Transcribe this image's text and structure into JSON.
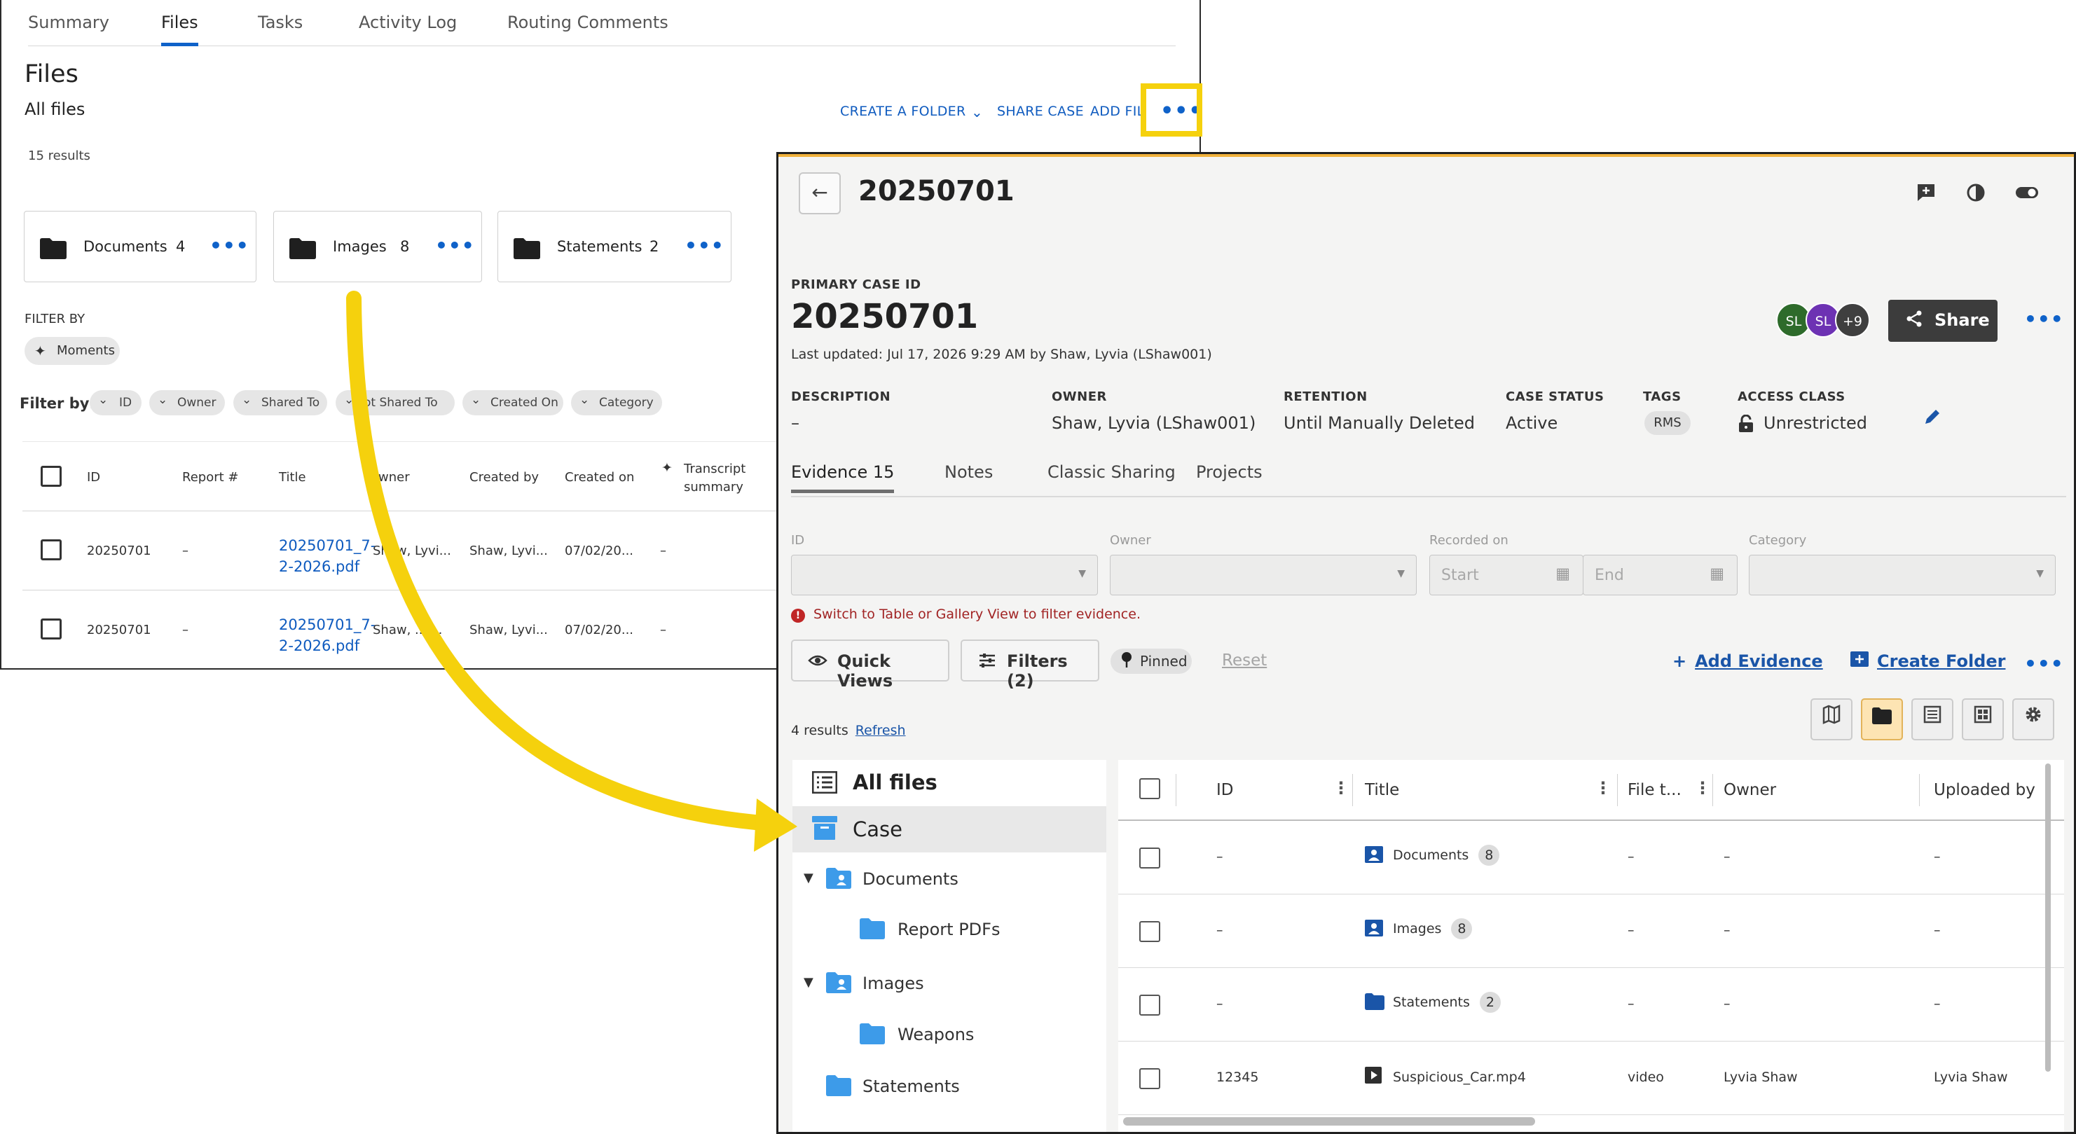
{
  "back_panel": {
    "tabs": [
      "Summary",
      "Files",
      "Tasks",
      "Activity Log",
      "Routing Comments"
    ],
    "title": "Files",
    "subtitle": "All files",
    "results": "15 results",
    "actions": {
      "create_folder": "CREATE A FOLDER",
      "share_case": "SHARE CASE",
      "add_file": "ADD FIL",
      "more": "•••"
    },
    "folders": [
      {
        "name": "Documents",
        "count": "4"
      },
      {
        "name": "Images",
        "count": "8"
      },
      {
        "name": "Statements",
        "count": "2"
      }
    ],
    "filter_by_heading": "FILTER BY",
    "moments_chip": "Moments",
    "filter_by_label": "Filter by:",
    "filter_chips": [
      "ID",
      "Owner",
      "Shared To",
      "ot Shared To",
      "Created On",
      "Category"
    ],
    "table": {
      "headers": [
        "ID",
        "Report #",
        "Title",
        "wner",
        "Created by",
        "Created on",
        "Transcript summary"
      ],
      "rows": [
        {
          "id": "20250701",
          "report": "–",
          "title": "20250701_7-2-2026.pdf",
          "owner": "Shaw, Lyvi...",
          "created_by": "Shaw, Lyvi...",
          "created_on": "07/02/20...",
          "transcript": "–"
        },
        {
          "id": "20250701",
          "report": "–",
          "title": "20250701_7-2-2026.pdf",
          "owner": "Shaw, ...i...",
          "created_by": "Shaw, Lyvi...",
          "created_on": "07/02/20...",
          "transcript": "–"
        }
      ]
    }
  },
  "front_panel": {
    "header_title": "20250701",
    "primary_case_label": "PRIMARY CASE ID",
    "case_id": "20250701",
    "last_updated": "Last updated: Jul 17, 2026 9:29 AM by Shaw, Lyvia (LShaw001)",
    "avatars": [
      {
        "initials": "SL",
        "color": "#2e6b2b"
      },
      {
        "initials": "SL",
        "color": "#6d32b3"
      },
      {
        "initials": "+9",
        "color": "#3f3f3f"
      }
    ],
    "share_button": "Share",
    "meta": [
      {
        "label": "DESCRIPTION",
        "value": "–"
      },
      {
        "label": "OWNER",
        "value": "Shaw, Lyvia (LShaw001)"
      },
      {
        "label": "RETENTION",
        "value": "Until Manually Deleted"
      },
      {
        "label": "CASE STATUS",
        "value": "Active"
      },
      {
        "label": "TAGS",
        "value": "RMS"
      },
      {
        "label": "ACCESS CLASS",
        "value": "Unrestricted"
      }
    ],
    "tabs": [
      "Evidence 15",
      "Notes",
      "Classic Sharing",
      "Projects"
    ],
    "filters": {
      "id_label": "ID",
      "owner_label": "Owner",
      "recorded_label": "Recorded on",
      "start_placeholder": "Start",
      "end_placeholder": "End",
      "category_label": "Category"
    },
    "warning": "Switch to Table or Gallery View to filter evidence.",
    "quick_views": "Quick Views",
    "filters_button": "Filters (2)",
    "pinned": "Pinned",
    "reset": "Reset",
    "add_evidence": "Add Evidence",
    "create_folder": "Create Folder",
    "results": "4 results",
    "refresh": "Refresh",
    "tree": [
      {
        "label": "All files"
      },
      {
        "label": "Case"
      },
      {
        "label": "Documents"
      },
      {
        "label": "Report PDFs"
      },
      {
        "label": "Images"
      },
      {
        "label": "Weapons"
      },
      {
        "label": "Statements"
      }
    ],
    "table": {
      "headers": [
        "ID",
        "Title",
        "File t...",
        "Owner",
        "Uploaded by"
      ],
      "rows": [
        {
          "id": "–",
          "title": "Documents",
          "badge": "8",
          "type": "–",
          "owner": "–",
          "uploaded": "–"
        },
        {
          "id": "–",
          "title": "Images",
          "badge": "8",
          "type": "–",
          "owner": "–",
          "uploaded": "–"
        },
        {
          "id": "–",
          "title": "Statements",
          "badge": "2",
          "type": "–",
          "owner": "–",
          "uploaded": "–"
        },
        {
          "id": "12345",
          "title": "Suspicious_Car.mp4",
          "badge": "",
          "type": "video",
          "owner": "Lyvia Shaw",
          "uploaded": "Lyvia Shaw"
        }
      ]
    }
  },
  "colors": {
    "highlight": "#f5d10d",
    "link_blue": "#0f5bbf",
    "folder_blue": "#3d9be9",
    "selected_view": "#fde4b3"
  }
}
